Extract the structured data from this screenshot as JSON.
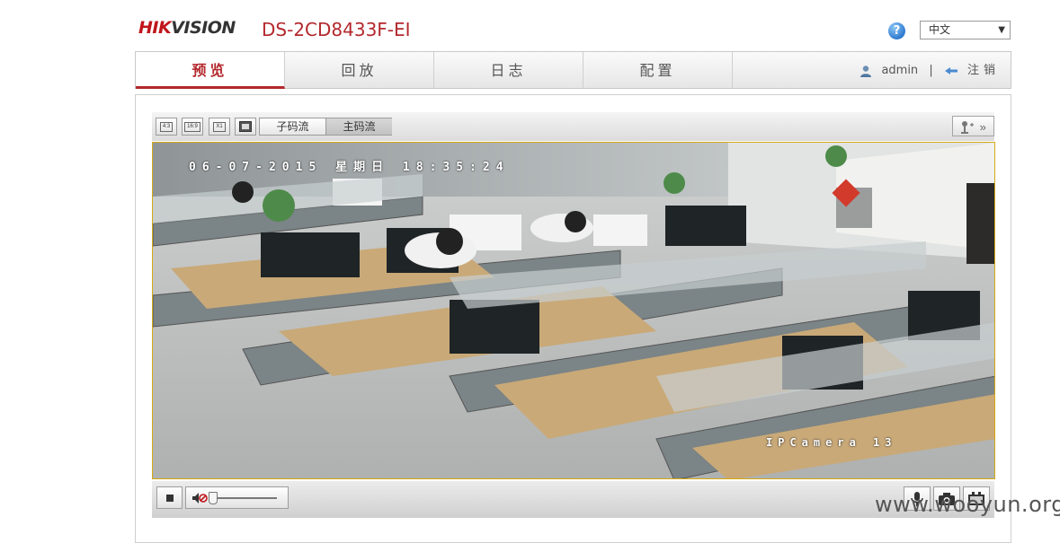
{
  "header": {
    "logo_hik": "HIK",
    "logo_vision": "VISION",
    "model": "DS-2CD8433F-EI",
    "help_symbol": "?",
    "language_selected": "中文",
    "help_icon": "question-circle-icon"
  },
  "nav": {
    "tabs": [
      {
        "label": "预览",
        "active": true
      },
      {
        "label": "回放",
        "active": false
      },
      {
        "label": "日志",
        "active": false
      },
      {
        "label": "配置",
        "active": false
      }
    ],
    "username": "admin",
    "separator": "|",
    "logout_label": "注销"
  },
  "toolbar": {
    "aspect_buttons": [
      "4:3",
      "16:9",
      "X1"
    ],
    "stream_sub": "子码流",
    "stream_main": "主码流",
    "ptz_arrow": "»"
  },
  "video": {
    "osd_datetime": "06-07-2015 星期日 18:35:24",
    "osd_camera": "IPCamera 13"
  },
  "watermark": "www.wooyun.org",
  "colors": {
    "brand_red": "#b3282d",
    "video_border": "#d6a914"
  }
}
